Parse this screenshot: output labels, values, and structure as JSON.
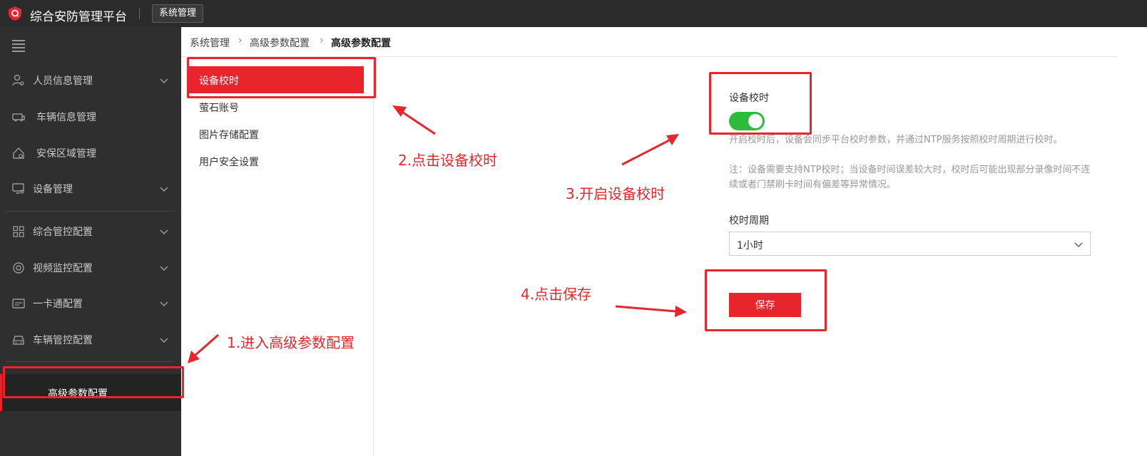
{
  "app": {
    "title": "综合安防管理平台",
    "module_button": "系统管理"
  },
  "sidebar": {
    "items": [
      {
        "label": "人员信息管理",
        "icon": "person-icon",
        "chevron": "down"
      },
      {
        "label": "车辆信息管理",
        "icon": "vehicle-icon",
        "chevron": ""
      },
      {
        "label": "安保区域管理",
        "icon": "home-area-icon",
        "chevron": ""
      },
      {
        "label": "设备管理",
        "icon": "device-icon",
        "chevron": "down"
      },
      {
        "label": "综合管控配置",
        "icon": "grid-icon",
        "chevron": "down"
      },
      {
        "label": "视频监控配置",
        "icon": "camera-icon",
        "chevron": "down"
      },
      {
        "label": "一卡通配置",
        "icon": "card-icon",
        "chevron": "down"
      },
      {
        "label": "车辆管控配置",
        "icon": "car-icon",
        "chevron": "down"
      },
      {
        "label": "高级参数配置",
        "icon": "gear-icon",
        "chevron": "up"
      }
    ],
    "sub_item": "高级参数配置"
  },
  "breadcrumb": [
    "系统管理",
    "高级参数配置",
    "高级参数配置"
  ],
  "submenu": [
    "设备校时",
    "萤石账号",
    "图片存储配置",
    "用户安全设置"
  ],
  "form": {
    "time_sync_label": "设备校时",
    "time_sync_enabled": true,
    "help_line1": "开启校时后，设备会同步平台校时参数，并通过NTP服务按照校时周期进行校时。",
    "help_line2": "注：设备需要支持NTP校时；当设备时间误差较大时，校时后可能出现部分录像时间不连续或者门禁刷卡时间有偏差等异常情况。",
    "period_label": "校时周期",
    "period_value": "1小时",
    "save_label": "保存"
  },
  "annotations": {
    "step1": "1.进入高级参数配置",
    "step2": "2.点击设备校时",
    "step3": "3.开启设备校时",
    "step4": "4.点击保存"
  },
  "colors": {
    "topbar": "#2b2b2b",
    "sidebar": "#2f2f2f",
    "accent_red": "#e8252d",
    "toggle_on": "#2bbd3a"
  }
}
